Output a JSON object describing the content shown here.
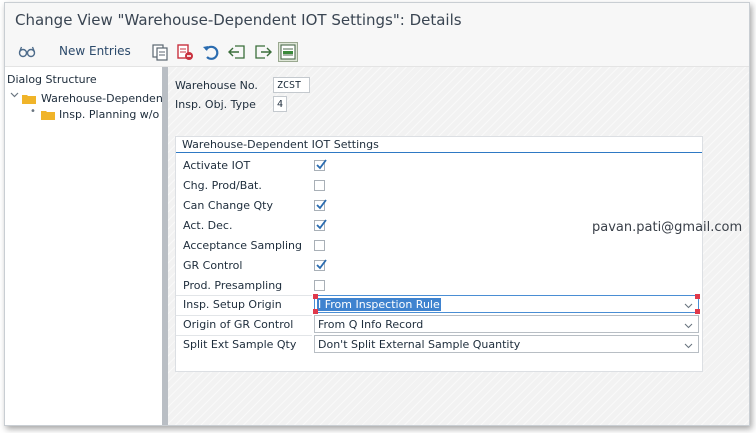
{
  "window": {
    "title": "Change View \"Warehouse-Dependent IOT Settings\": Details"
  },
  "toolbar": {
    "new_entries_label": "New Entries",
    "icons": [
      "glasses-display-change-icon",
      "copy-icon",
      "delete-icon",
      "undo-icon",
      "previous-entry-icon",
      "next-entry-icon",
      "select-block-icon"
    ]
  },
  "dialog_structure": {
    "header": "Dialog Structure",
    "items": [
      {
        "label": "Warehouse-Dependent",
        "selected": true,
        "expanded": true
      },
      {
        "label": "Insp. Planning w/o Ru",
        "selected": false
      }
    ]
  },
  "header_fields": {
    "warehouse_no": {
      "label": "Warehouse No.",
      "value": "ZCST"
    },
    "insp_obj_type": {
      "label": "Insp. Obj. Type",
      "value": "4"
    }
  },
  "settings_group": {
    "title": "Warehouse-Dependent IOT Settings",
    "checkboxes": [
      {
        "label": "Activate IOT",
        "checked": true
      },
      {
        "label": "Chg. Prod/Bat.",
        "checked": false
      },
      {
        "label": "Can Change Qty",
        "checked": true
      },
      {
        "label": "Act. Dec.",
        "checked": true
      },
      {
        "label": "Acceptance Sampling",
        "checked": false
      },
      {
        "label": "GR Control",
        "checked": true
      },
      {
        "label": "Prod. Presampling",
        "checked": false
      }
    ],
    "dropdowns": [
      {
        "label": "Insp. Setup Origin",
        "value": "I From Inspection Rule",
        "focused": true
      },
      {
        "label": "Origin of GR Control",
        "value": "From Q Info Record",
        "focused": false
      },
      {
        "label": "Split Ext Sample Qty",
        "value": "Don't Split External Sample Quantity",
        "focused": false
      }
    ]
  },
  "watermark": {
    "email": "pavan.pati@gmail.com"
  },
  "colors": {
    "accent": "#2e79c4",
    "checkmark": "#2b6cb0",
    "selection": "#3f83cf",
    "folder": "#f0b429"
  }
}
